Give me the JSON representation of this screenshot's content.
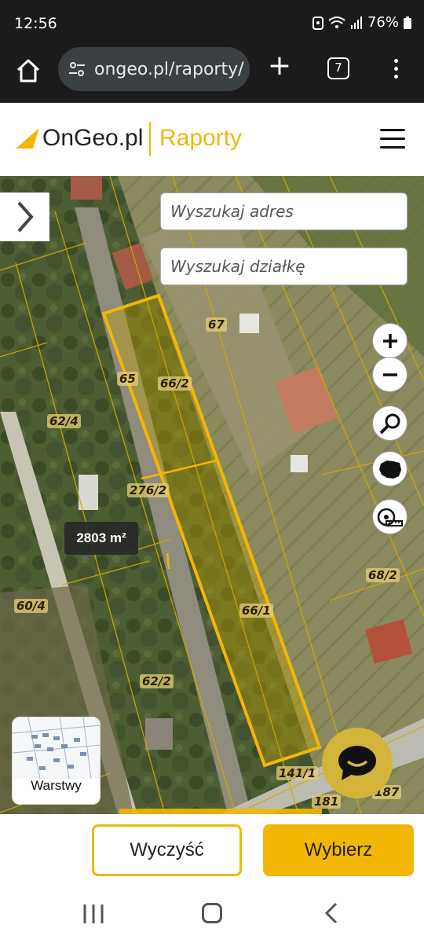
{
  "status_bar": {
    "time": "12:56",
    "battery": "76%"
  },
  "browser": {
    "url": "ongeo.pl/raporty/",
    "tab_count": "7"
  },
  "site": {
    "brand": "OnGeo.pl",
    "section": "Raporty"
  },
  "map": {
    "search_address_placeholder": "Wyszukaj adres",
    "search_plot_placeholder": "Wyszukaj działkę",
    "area": "2803 m²",
    "layers_label": "Warstwy",
    "parcel_labels": [
      "67",
      "65",
      "66/2",
      "62/4",
      "276/2",
      "68/2",
      "60/4",
      "66/1",
      "62/2",
      "141/1",
      "181",
      "187"
    ]
  },
  "actions": {
    "clear_label": "Wyczyść",
    "select_label": "Wybierz"
  },
  "colors": {
    "accent": "#f2b705",
    "status_bg": "#1b1b1b",
    "chat": "#d3b43a"
  },
  "icons": [
    "home-icon",
    "tune-icon",
    "plus-icon",
    "tabs-icon",
    "more-icon",
    "menu-icon",
    "chevron-right-icon",
    "zoom-in-icon",
    "zoom-out-icon",
    "search-icon",
    "poland-map-icon",
    "measure-tape-icon",
    "layers-icon",
    "chat-icon"
  ]
}
